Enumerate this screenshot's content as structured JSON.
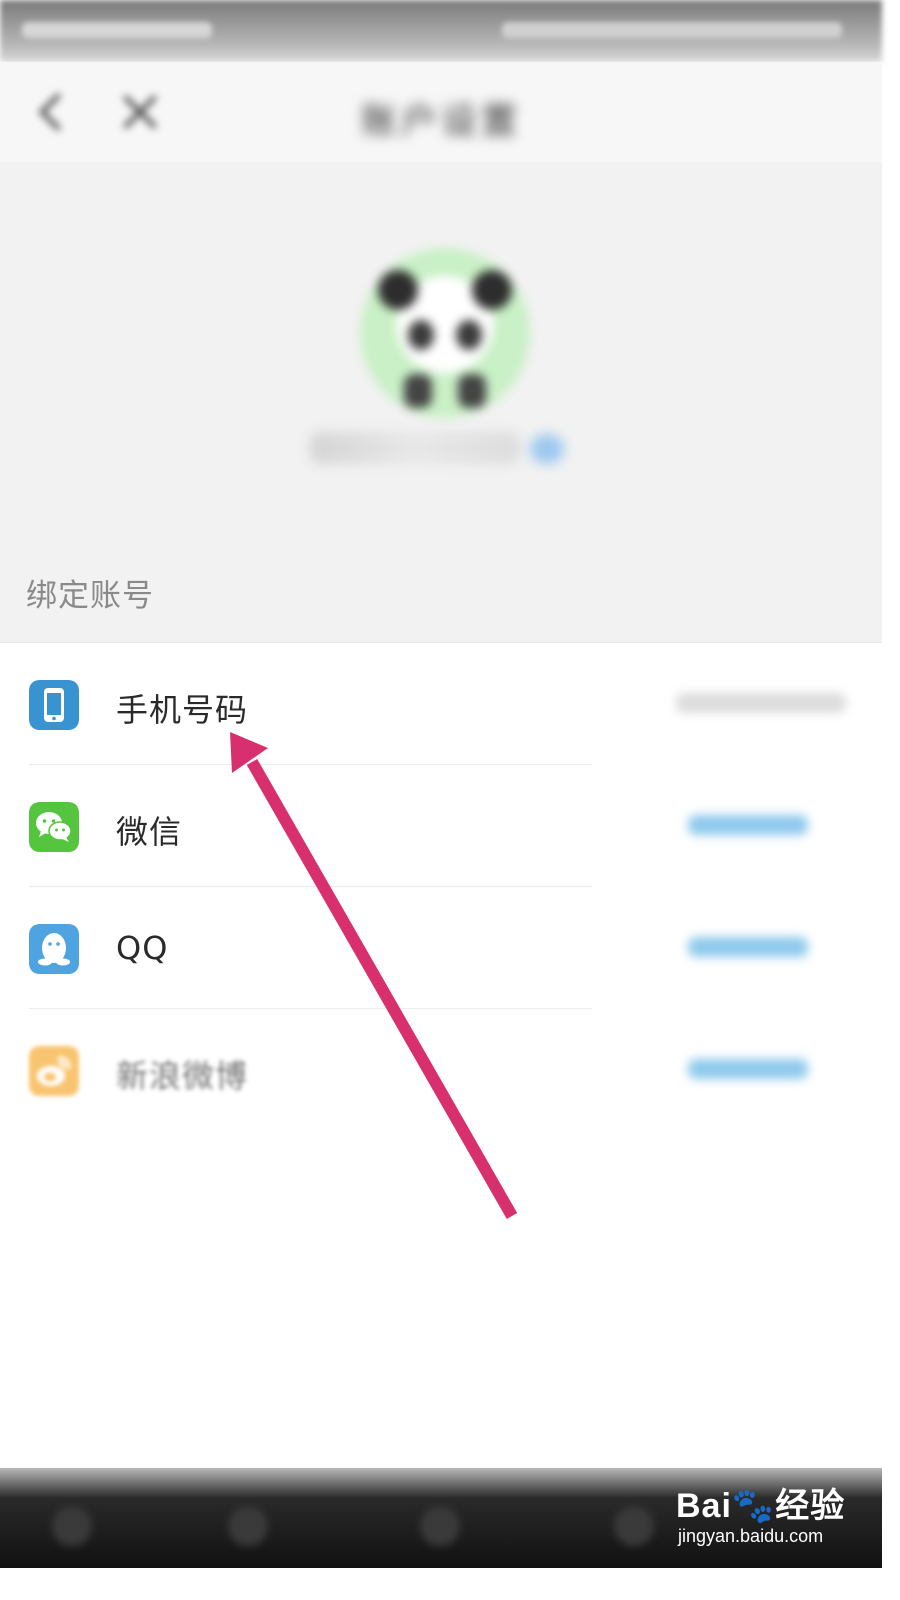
{
  "nav": {
    "title": "账户设置"
  },
  "section": {
    "title": "绑定账号"
  },
  "accounts": [
    {
      "label": "手机号码",
      "icon": "phone-icon",
      "color": "#3a93d1"
    },
    {
      "label": "微信",
      "icon": "wechat-icon",
      "color": "#55c43e"
    },
    {
      "label": "QQ",
      "icon": "qq-icon",
      "color": "#4ea3e0"
    },
    {
      "label": "新浪微博",
      "icon": "weibo-icon",
      "color": "#f5a623"
    }
  ],
  "colors": {
    "annotation_arrow": "#d8306e",
    "link_blue": "#8ec9ec"
  },
  "watermark": {
    "logo": "Bai🐾经验",
    "url": "jingyan.baidu.com"
  }
}
